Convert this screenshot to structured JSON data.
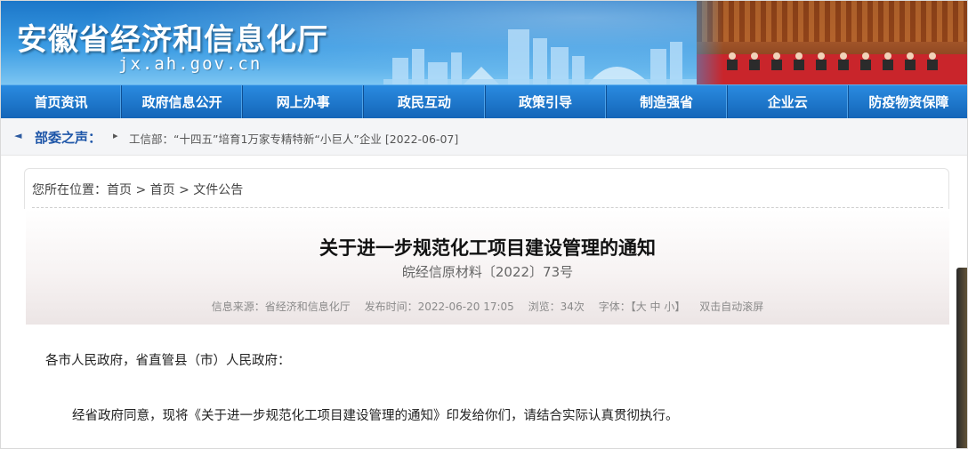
{
  "header": {
    "site_title": "安徽省经济和信息化厅",
    "site_domain": "jx.ah.gov.cn"
  },
  "nav": {
    "items": [
      "首页资讯",
      "政府信息公开",
      "网上办事",
      "政民互动",
      "政策引导",
      "制造强省",
      "企业云",
      "防疫物资保障"
    ]
  },
  "ticker": {
    "label": "部委之声：",
    "headline": "工信部：“十四五”培育1万家专精特新“小巨人”企业 [2022-06-07]"
  },
  "breadcrumb": {
    "text": "您所在位置：首页 > 首页 > 文件公告"
  },
  "article": {
    "title": "关于进一步规范化工项目建设管理的通知",
    "doc_number": "皖经信原材料〔2022〕73号",
    "meta": {
      "source": "信息来源：省经济和信息化厅",
      "published": "发布时间：2022-06-20 17:05",
      "views": "浏览：34次",
      "font_size": "字体：【大 中 小】",
      "autoscroll": "双击自动滚屏"
    },
    "salutation": "各市人民政府，省直管县（市）人民政府：",
    "paragraph": "经省政府同意，现将《关于进一步规范化工项目建设管理的通知》印发给你们，请结合实际认真贯彻执行。"
  },
  "colors": {
    "nav_blue": "#1466b8",
    "header_blue": "#1c77c9",
    "ticker_label": "#1e56a8"
  }
}
